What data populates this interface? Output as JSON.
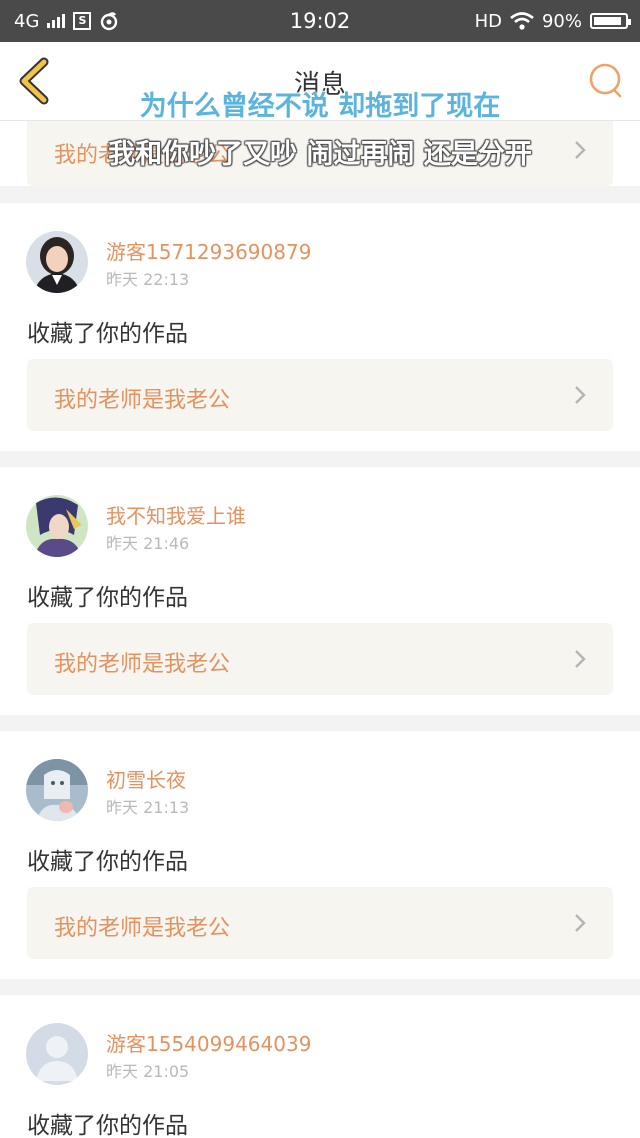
{
  "status_bar": {
    "network": "4G",
    "sim_icon": "S",
    "time": "19:02",
    "hd": "HD",
    "battery": "90%",
    "battery_level": 0.9
  },
  "header": {
    "title": "消息"
  },
  "lyrics": {
    "line1": "为什么曾经不说 却拖到了现在",
    "line2": "我和你吵了又吵 闹过再闹 还是分开"
  },
  "partial_top_card": {
    "work_title": "我的老师是我老公"
  },
  "messages": [
    {
      "username": "游客1571293690879",
      "time": "昨天 22:13",
      "action": "收藏了你的作品",
      "work_title": "我的老师是我老公",
      "avatar": "photo-avatar-woman"
    },
    {
      "username": "我不知我爱上谁",
      "time": "昨天 21:46",
      "action": "收藏了你的作品",
      "work_title": "我的老师是我老公",
      "avatar": "anime-avatar"
    },
    {
      "username": "初雪长夜",
      "time": "昨天 21:13",
      "action": "收藏了你的作品",
      "work_title": "我的老师是我老公",
      "avatar": "illustration-avatar"
    },
    {
      "username": "游客1554099464039",
      "time": "昨天 21:05",
      "action": "收藏了你的作品",
      "avatar": "default-avatar"
    }
  ],
  "colors": {
    "accent": "#e5925f",
    "status_bar_bg": "#4a4a4a",
    "lyric_blue": "#5bb4dd",
    "work_card_bg": "#f6f5f0"
  }
}
